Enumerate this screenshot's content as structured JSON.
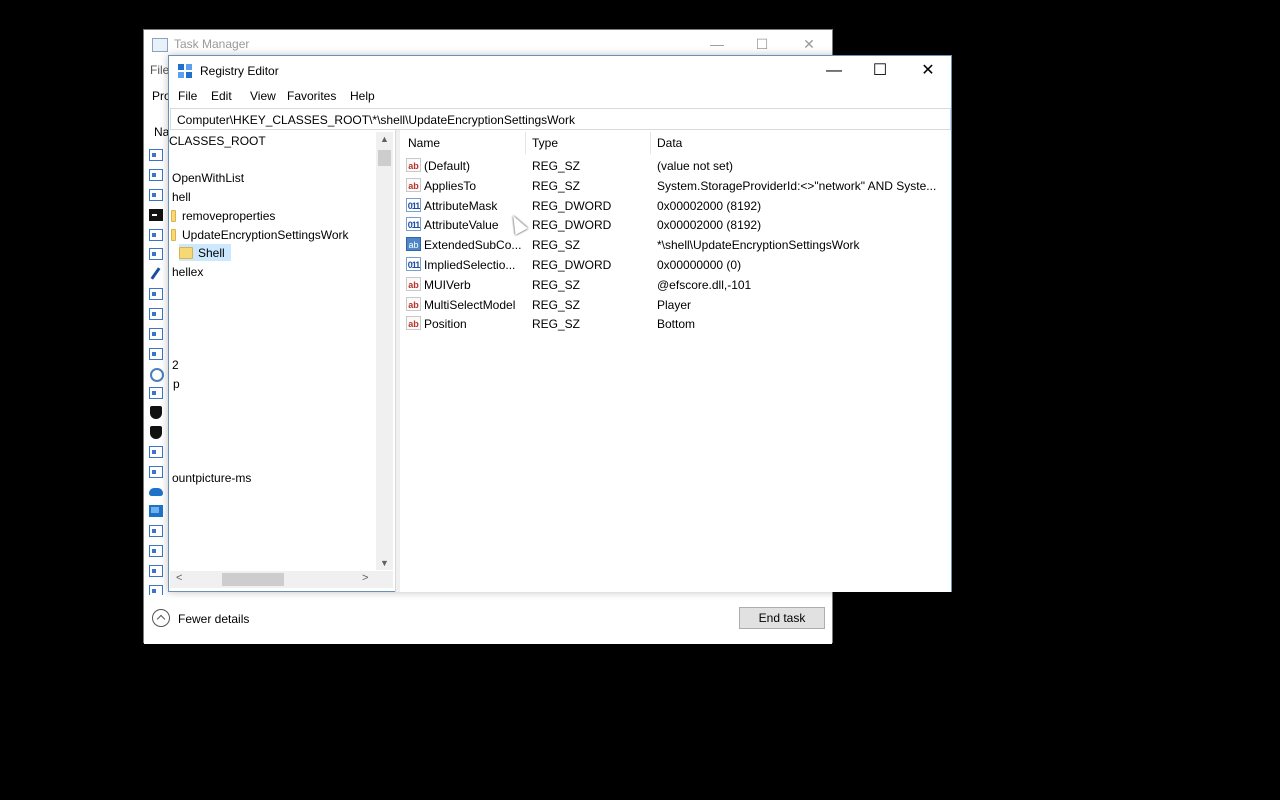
{
  "task_manager": {
    "title": "Task Manager",
    "menu_file": "File",
    "tab_partial": "Pro",
    "column_partial": "Na",
    "fewer_details": "Fewer details",
    "end_task": "End task",
    "controls": {
      "minimize": "—",
      "maximize": "☐",
      "close": "✕"
    }
  },
  "registry": {
    "title": "Registry Editor",
    "controls": {
      "minimize": "—",
      "maximize": "☐",
      "close": "✕"
    },
    "menu": [
      "File",
      "Edit",
      "View",
      "Favorites",
      "Help"
    ],
    "address": "Computer\\HKEY_CLASSES_ROOT\\*\\shell\\UpdateEncryptionSettingsWork",
    "tree": {
      "root": "CLASSES_ROOT",
      "openwithlist": "OpenWithList",
      "shell": "hell",
      "removeproperties": "removeproperties",
      "update": "UpdateEncryptionSettingsWork",
      "shell_child": "Shell",
      "shellex": "hellex",
      "partial_2": "2",
      "partial_p": "p",
      "accountpicture": "ountpicture-ms"
    },
    "columns": {
      "name": "Name",
      "type": "Type",
      "data": "Data"
    },
    "values": [
      {
        "icon": "ab",
        "name": "(Default)",
        "type": "REG_SZ",
        "data": "(value not set)"
      },
      {
        "icon": "ab",
        "name": "AppliesTo",
        "type": "REG_SZ",
        "data": "System.StorageProviderId:<>\"network\" AND Syste..."
      },
      {
        "icon": "dword",
        "name": "AttributeMask",
        "type": "REG_DWORD",
        "data": "0x00002000 (8192)"
      },
      {
        "icon": "dword",
        "name": "AttributeValue",
        "type": "REG_DWORD",
        "data": "0x00002000 (8192)"
      },
      {
        "icon": "expand",
        "name": "ExtendedSubCo...",
        "type": "REG_SZ",
        "data": "*\\shell\\UpdateEncryptionSettingsWork"
      },
      {
        "icon": "dword",
        "name": "ImpliedSelectio...",
        "type": "REG_DWORD",
        "data": "0x00000000 (0)"
      },
      {
        "icon": "ab",
        "name": "MUIVerb",
        "type": "REG_SZ",
        "data": "@efscore.dll,-101"
      },
      {
        "icon": "ab",
        "name": "MultiSelectModel",
        "type": "REG_SZ",
        "data": "Player"
      },
      {
        "icon": "ab",
        "name": "Position",
        "type": "REG_SZ",
        "data": "Bottom"
      }
    ],
    "icon_labels": {
      "ab": "ab",
      "dword": "011",
      "expand": "ab"
    }
  }
}
